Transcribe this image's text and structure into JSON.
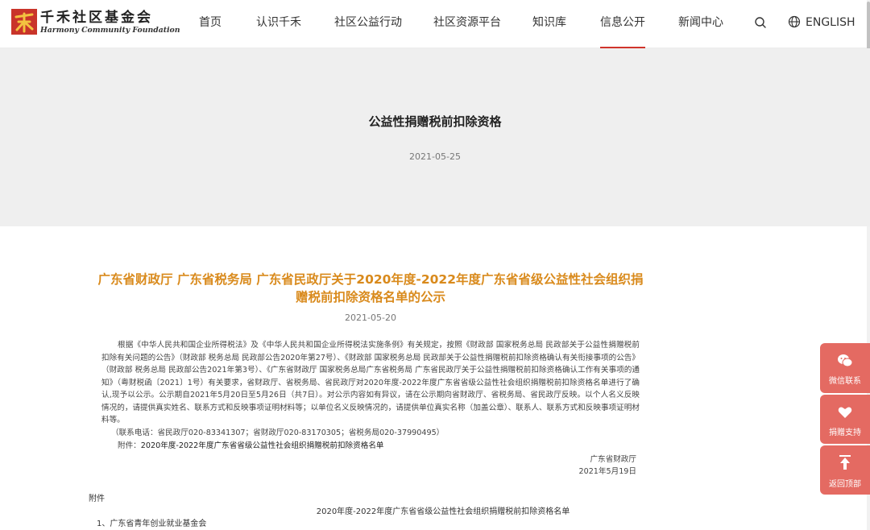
{
  "header": {
    "logo_cn": "千禾社区基金会",
    "logo_en": "Harmony Community Foundation",
    "nav": [
      {
        "label": "首页"
      },
      {
        "label": "认识千禾"
      },
      {
        "label": "社区公益行动"
      },
      {
        "label": "社区资源平台"
      },
      {
        "label": "知识库"
      },
      {
        "label": "信息公开",
        "active": true
      },
      {
        "label": "新闻中心"
      }
    ],
    "language": "ENGLISH"
  },
  "banner": {
    "title": "公益性捐赠税前扣除资格",
    "date": "2021-05-25"
  },
  "article": {
    "title": "广东省财政厅 广东省税务局 广东省民政厅关于2020年度-2022年度广东省省级公益性社会组织捐赠税前扣除资格名单的公示",
    "date": "2021-05-20",
    "body": "根据《中华人民共和国企业所得税法》及《中华人民共和国企业所得税法实施条例》有关规定，按照《财政部 国家税务总局 民政部关于公益性捐赠税前扣除有关问题的公告》（财政部 税务总局 民政部公告2020年第27号）、《财政部 国家税务总局 民政部关于公益性捐赠税前扣除资格确认有关衔接事项的公告》（财政部 税务总局 民政部公告2021年第3号）、《广东省财政厅 国家税务总局广东省税务局 广东省民政厅关于公益性捐赠税前扣除资格确认工作有关事项的通知》（粤财税函〔2021〕1号）有关要求，省财政厅、省税务局、省民政厅对2020年度-2022年度广东省省级公益性社会组织捐赠税前扣除资格名单进行了确认,现予以公示。公示期自2021年5月20日至5月26日（共7日）。对公示内容如有异议，请在公示期向省财政厅、省税务局、省民政厅反映。以个人名义反映情况的，请提供真实姓名、联系方式和反映事项证明材料等；以单位名义反映情况的，请提供单位真实名称（加盖公章）、联系人、联系方式和反映事项证明材料等。",
    "contact": "（联系电话：省民政厅020-83341307；省财政厅020-83170305；省税务局020-37990495）",
    "attachment_label": "附件：",
    "attachment_link": "2020年度-2022年度广东省省级公益性社会组织捐赠税前扣除资格名单",
    "signer": "广东省财政厅",
    "sign_date": "2021年5月19日",
    "appendix_label": "附件",
    "appendix_title": "2020年度-2022年度广东省省级公益性社会组织捐赠税前扣除资格名单",
    "appendix_first_item": "1、广东省青年创业就业基金会"
  },
  "sidebar": {
    "wechat": "微信联系",
    "donate": "捐赠支持",
    "top": "返回顶部"
  },
  "colors": {
    "accent_red": "#d0342c",
    "title_orange": "#d98a1c",
    "side_button": "#e46a62",
    "banner_bg": "#efefef"
  },
  "icons": [
    "logo-mark-icon",
    "search-icon",
    "globe-icon",
    "wechat-icon",
    "heart-hand-icon",
    "arrow-up-icon"
  ]
}
